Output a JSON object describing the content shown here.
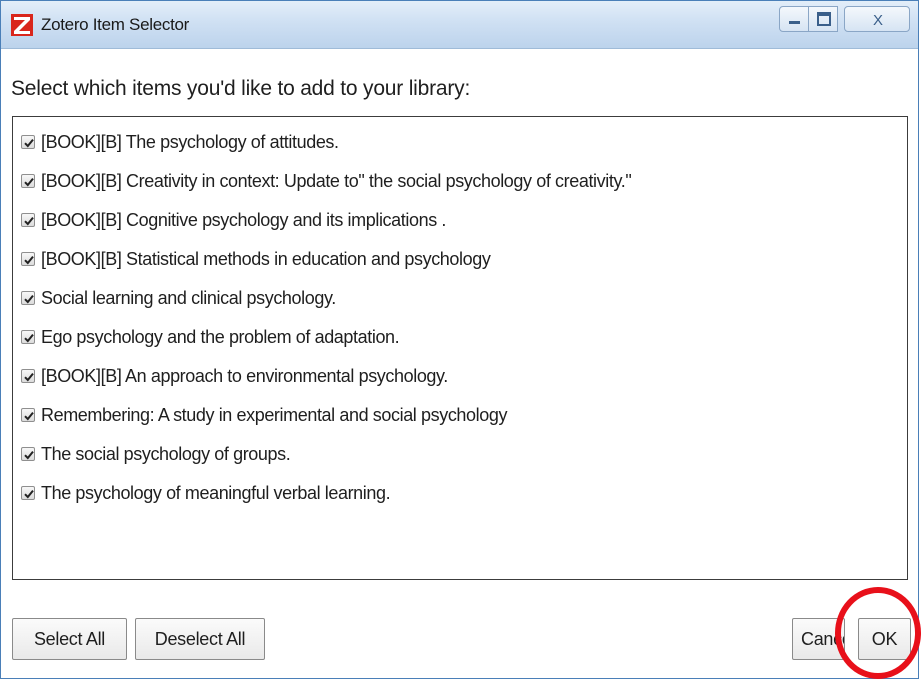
{
  "window": {
    "title": "Zotero Item Selector",
    "logo_icon": "zotero-logo-icon",
    "controls": [
      "minimize-icon",
      "maximize-icon",
      "close-icon"
    ],
    "close_label": "X"
  },
  "prompt": "Select which items you'd like to add to your library:",
  "items": [
    {
      "label": "[BOOK][B] The psychology of attitudes.",
      "checked": true
    },
    {
      "label": "[BOOK][B] Creativity in context: Update to\" the social psychology of creativity.\"",
      "checked": true
    },
    {
      "label": "[BOOK][B] Cognitive psychology and its implications .",
      "checked": true
    },
    {
      "label": "[BOOK][B] Statistical methods in education and psychology",
      "checked": true
    },
    {
      "label": "Social learning and clinical psychology.",
      "checked": true
    },
    {
      "label": "Ego psychology and the problem of adaptation.",
      "checked": true
    },
    {
      "label": "[BOOK][B] An approach to environmental psychology.",
      "checked": true
    },
    {
      "label": "Remembering: A study in experimental and social psychology",
      "checked": true
    },
    {
      "label": "The social psychology of groups.",
      "checked": true
    },
    {
      "label": "The psychology of meaningful verbal learning.",
      "checked": true
    }
  ],
  "buttons": {
    "select_all": "Select All",
    "deselect_all": "Deselect All",
    "cancel": "Cancel",
    "ok": "OK"
  },
  "colors": {
    "titlebar": "#cfe0f3",
    "logo": "#d9261c",
    "highlight": "#e8101a"
  }
}
